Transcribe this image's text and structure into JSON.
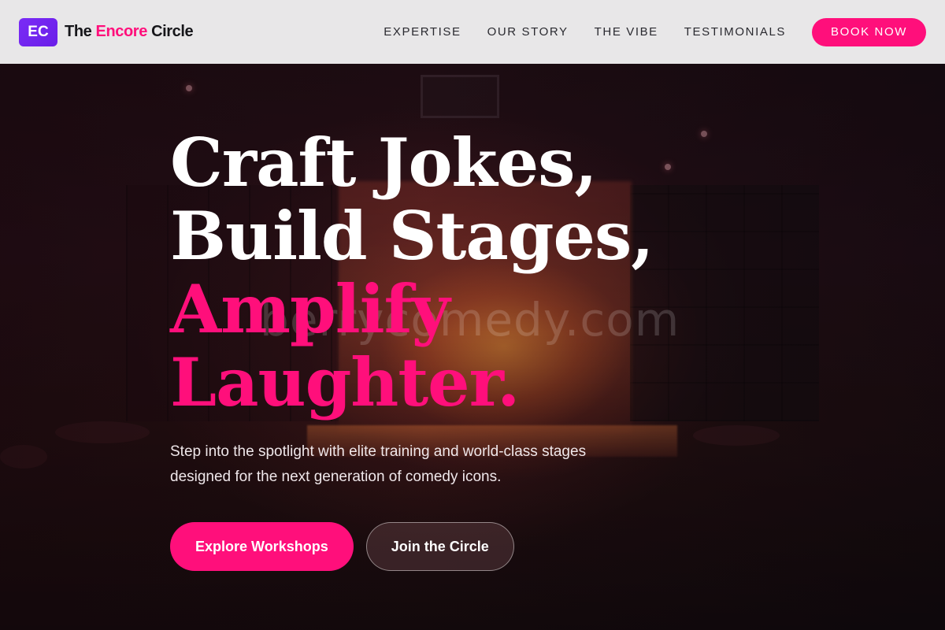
{
  "colors": {
    "accent": "#ff0f7b",
    "brand_badge": "#7a2cf6",
    "navbar_bg": "#e8e7e8",
    "text_dark": "#16161a",
    "hero_text": "#ffffff"
  },
  "navbar": {
    "logo_badge": "EC",
    "brand_name_start": "The ",
    "brand_name_accent": "Encore",
    "brand_name_end": " Circle",
    "links": [
      {
        "label": "EXPERTISE"
      },
      {
        "label": "OUR STORY"
      },
      {
        "label": "THE VIBE"
      },
      {
        "label": "TESTIMONIALS"
      }
    ],
    "cta_label": "BOOK NOW"
  },
  "hero": {
    "headline_lines": [
      {
        "text": "Craft Jokes,",
        "highlight": false
      },
      {
        "text": "Build Stages,",
        "highlight": false
      },
      {
        "text": "Amplify",
        "highlight": true
      },
      {
        "text": "Laughter.",
        "highlight": true
      }
    ],
    "subtitle": "Step into the spotlight with elite training and world-class stages designed for the next generation of comedy icons.",
    "primary_cta": "Explore Workshops",
    "secondary_cta": "Join the Circle",
    "watermark": "berrycomedy.com"
  }
}
